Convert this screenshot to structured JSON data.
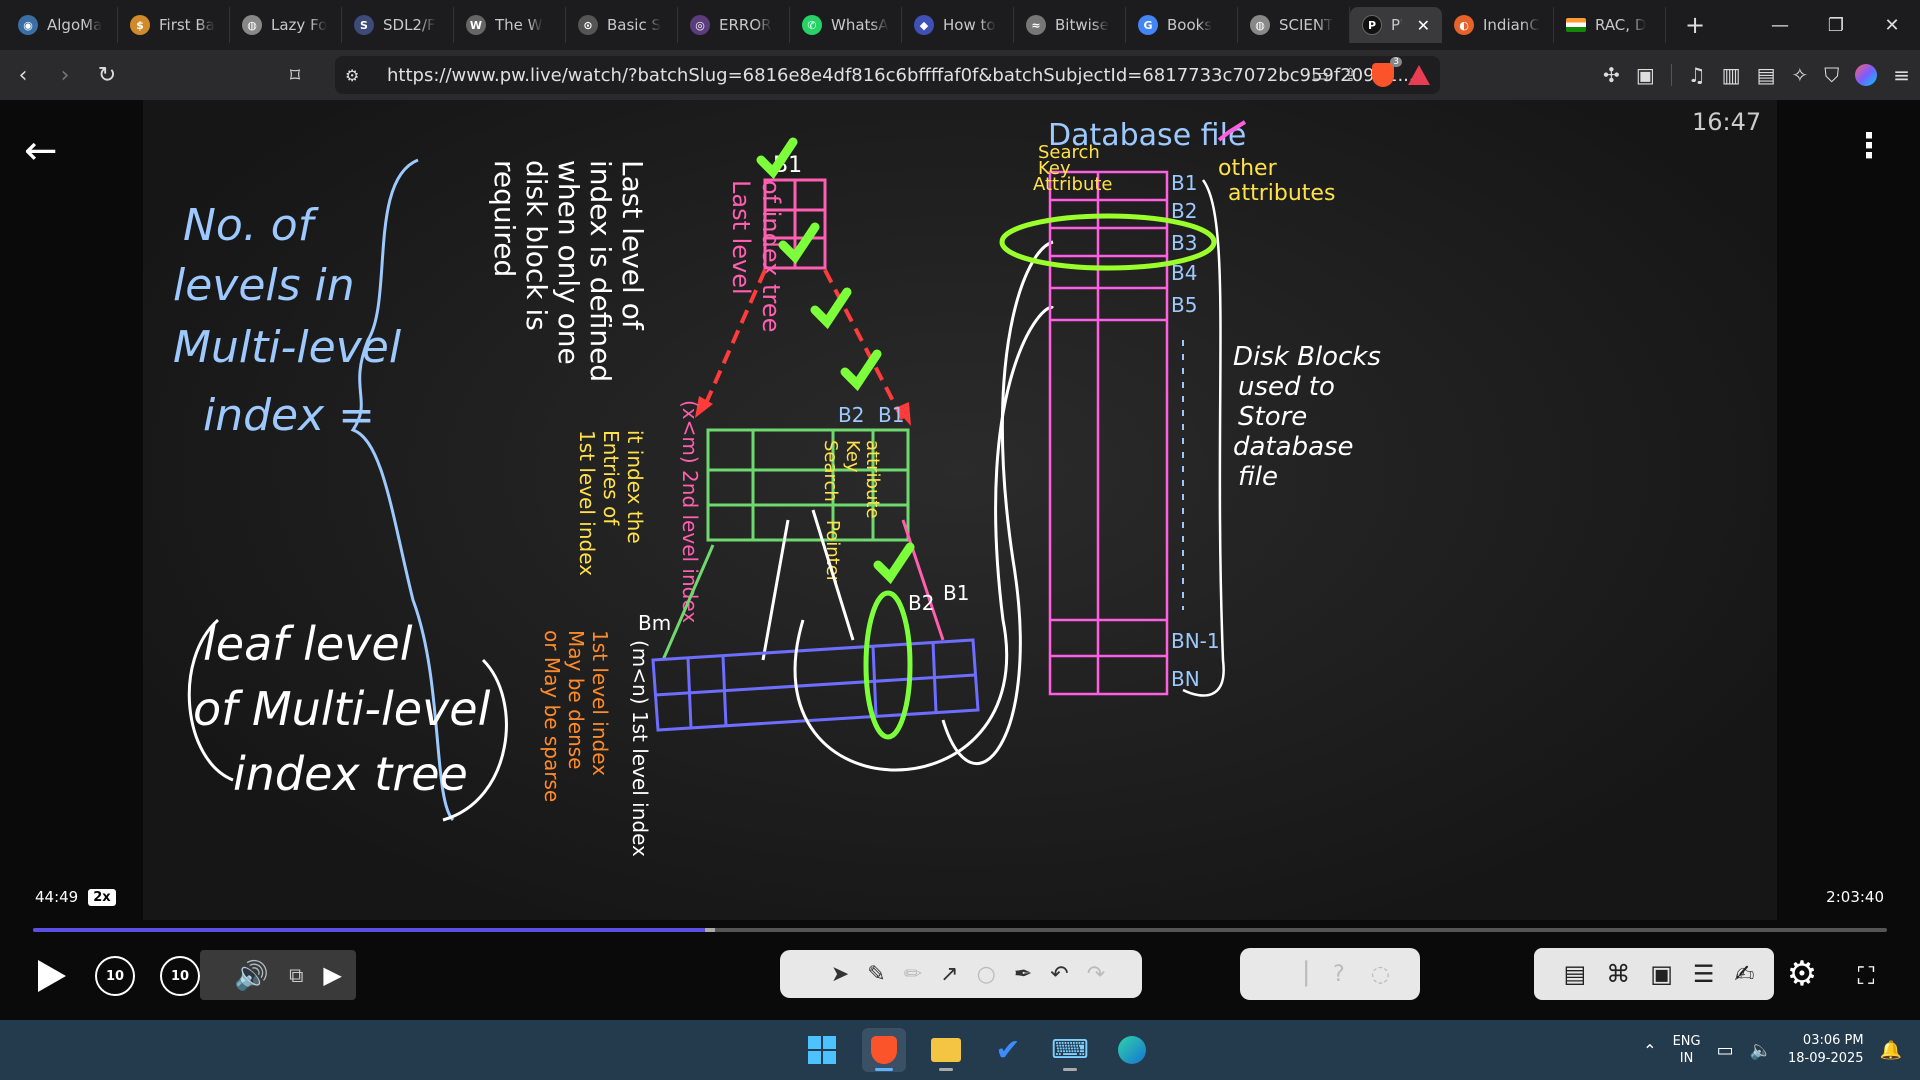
{
  "browser": {
    "tabs": [
      {
        "label": "AlgoMa",
        "icon": "algomaster-icon",
        "color": "#3a6ea5"
      },
      {
        "label": "First Ba",
        "icon": "first-bad-version-icon",
        "color": "#d08a2a"
      },
      {
        "label": "Lazy Fo",
        "icon": "globe-icon",
        "color": "#888888"
      },
      {
        "label": "SDL2/F",
        "icon": "sdl-icon",
        "color": "#3d4b78"
      },
      {
        "label": "The W",
        "icon": "wordpress-icon",
        "color": "#666666"
      },
      {
        "label": "Basic S",
        "icon": "basic-site-icon",
        "color": "#555555"
      },
      {
        "label": "ERROR",
        "icon": "error-site-icon",
        "color": "#5a3d7a"
      },
      {
        "label": "WhatsA",
        "icon": "whatsapp-icon",
        "color": "#25d366"
      },
      {
        "label": "How to",
        "icon": "how-to-icon",
        "color": "#3f51b5"
      },
      {
        "label": "Bitwise",
        "icon": "bitwise-icon",
        "color": "#777777"
      },
      {
        "label": "Books",
        "icon": "google-icon",
        "color": "#4285f4"
      },
      {
        "label": "SCIENT",
        "icon": "globe-icon",
        "color": "#888888"
      }
    ],
    "active_tab": {
      "label": "PW",
      "icon": "pw-icon",
      "close": "✕"
    },
    "tabs_after": [
      {
        "label": "IndianC",
        "icon": "indian-site-icon",
        "color": "#e5632b"
      },
      {
        "label": "RAC, D",
        "icon": "india-flag-icon",
        "color": "#ff9933"
      }
    ],
    "new_tab": "+",
    "url": "https://www.pw.live/watch/?batchSlug=6816e8e4df816c6bffffaf0f&batchSubjectId=6817733c7072bc959f209d1...",
    "shield_badge": "3"
  },
  "player": {
    "watermark_time": "16:47",
    "current_time": "44:49",
    "speed": "2x",
    "duration": "2:03:40",
    "progress_fraction": 0.3627,
    "buffer_fraction": 0.3677,
    "skip_back": "10",
    "skip_forward": "10"
  },
  "whiteboard": {
    "left_note": [
      "No. of",
      "levels in",
      "Multi-level",
      "index ="
    ],
    "leaf_note": [
      "leaf level",
      "of Multi-level",
      "index tree"
    ],
    "db_title": "Database file",
    "db_search_key": [
      "Search",
      "Key",
      "Attribute"
    ],
    "db_other": [
      "other",
      "attributes"
    ],
    "db_blocks": [
      "B1",
      "B2",
      "B3",
      "B4",
      "B5",
      "BN-1",
      "BN"
    ],
    "disk_note": [
      "Disk Blocks",
      "used to",
      "Store",
      "database",
      "file"
    ],
    "top_note": [
      "Last level of",
      "index is defined",
      "when only one",
      "disk block is",
      "required"
    ],
    "top_level_label": [
      "Last level",
      "of index tree"
    ],
    "top_b": "B1",
    "search_pointer": [
      "Search",
      "Key",
      "attribute",
      "Pointer"
    ],
    "second_level_label": "(x<m) 2nd level index",
    "second_level_note": [
      "it index the",
      "Entries of",
      "1st level index"
    ],
    "second_b": [
      "B1",
      "B2"
    ],
    "first_level_label": "(m<n) 1st level index",
    "first_level_note": [
      "1st level index",
      "May be dense",
      "or May be sparse"
    ],
    "first_b": [
      "Bm",
      "B2",
      "B1"
    ]
  },
  "taskbar": {
    "lang": "ENG",
    "region": "IN",
    "time": "03:06 PM",
    "date": "18-09-2025"
  }
}
